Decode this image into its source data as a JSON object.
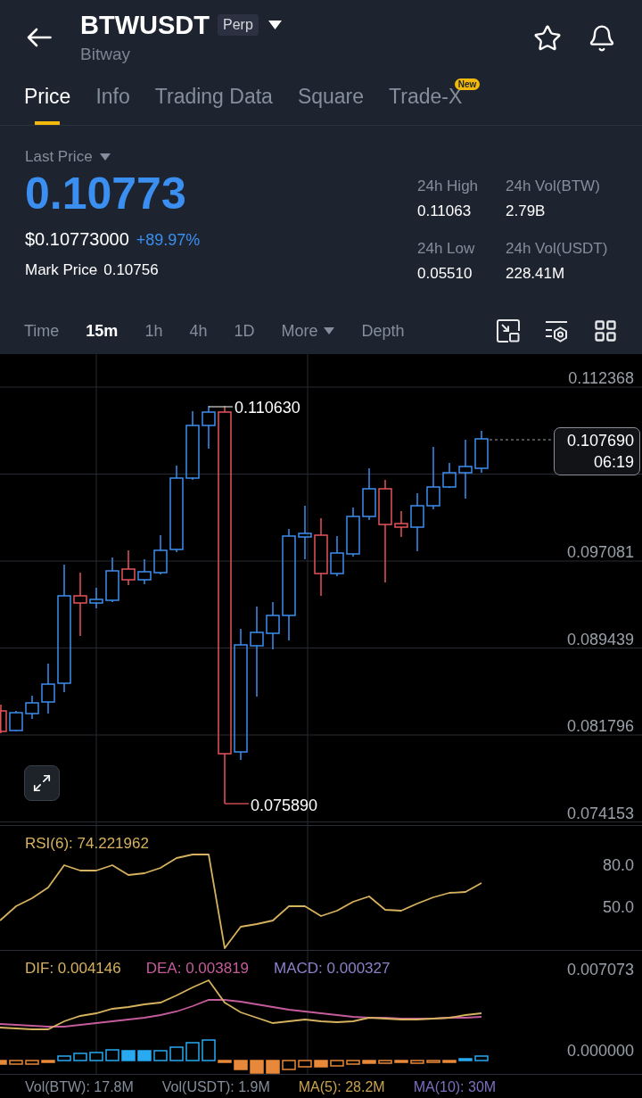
{
  "header": {
    "symbol": "BTWUSDT",
    "contract_badge": "Perp",
    "name": "Bitway"
  },
  "tabs": [
    {
      "label": "Price",
      "selected": true
    },
    {
      "label": "Info",
      "selected": false
    },
    {
      "label": "Trading Data",
      "selected": false
    },
    {
      "label": "Square",
      "selected": false
    },
    {
      "label": "Trade-X",
      "selected": false,
      "badge": "New"
    }
  ],
  "price_panel": {
    "price_type": "Last Price",
    "last_price": "0.10773",
    "usd_price": "$0.10773000",
    "change": "+89.97%",
    "mark_price_label": "Mark Price",
    "mark_price": "0.10756"
  },
  "stats": [
    {
      "label": "24h High",
      "value": "0.11063"
    },
    {
      "label": "24h Vol(BTW)",
      "value": "2.79B"
    },
    {
      "label": "24h Low",
      "value": "0.05510"
    },
    {
      "label": "24h Vol(USDT)",
      "value": "228.41M"
    }
  ],
  "intervals": [
    {
      "label": "Time",
      "selected": false,
      "has_menu": false
    },
    {
      "label": "15m",
      "selected": true,
      "has_menu": false
    },
    {
      "label": "1h",
      "selected": false,
      "has_menu": false
    },
    {
      "label": "4h",
      "selected": false,
      "has_menu": false
    },
    {
      "label": "1D",
      "selected": false,
      "has_menu": false
    },
    {
      "label": "More",
      "selected": false,
      "has_menu": true
    },
    {
      "label": "Depth",
      "selected": false,
      "has_menu": false
    }
  ],
  "price_chart": {
    "axis_labels": [
      "0.112368",
      "0.097081",
      "0.089439",
      "0.081796",
      "0.074153"
    ],
    "high_label": "0.110630",
    "low_label": "0.075890",
    "current_price": "0.107690",
    "countdown": "06:19"
  },
  "rsi": {
    "legend": "RSI(6): 74.221962",
    "axis_labels": [
      "80.0",
      "50.0"
    ]
  },
  "macd": {
    "legends": [
      {
        "text": "DIF: 0.004146",
        "color": "#d6b15e"
      },
      {
        "text": "DEA: 0.003819",
        "color": "#c45c9c"
      },
      {
        "text": "MACD: 0.000327",
        "color": "#8c80c8"
      }
    ],
    "axis_labels": [
      "0.007073",
      "0.000000"
    ]
  },
  "volume": [
    {
      "text": "Vol(BTW): 17.8M",
      "color": "#848e9c"
    },
    {
      "text": "Vol(USDT): 1.9M",
      "color": "#848e9c"
    },
    {
      "text": "MA(5): 28.2M",
      "color": "#c9a24f"
    },
    {
      "text": "MA(10): 30M",
      "color": "#7b6fc0"
    }
  ]
}
